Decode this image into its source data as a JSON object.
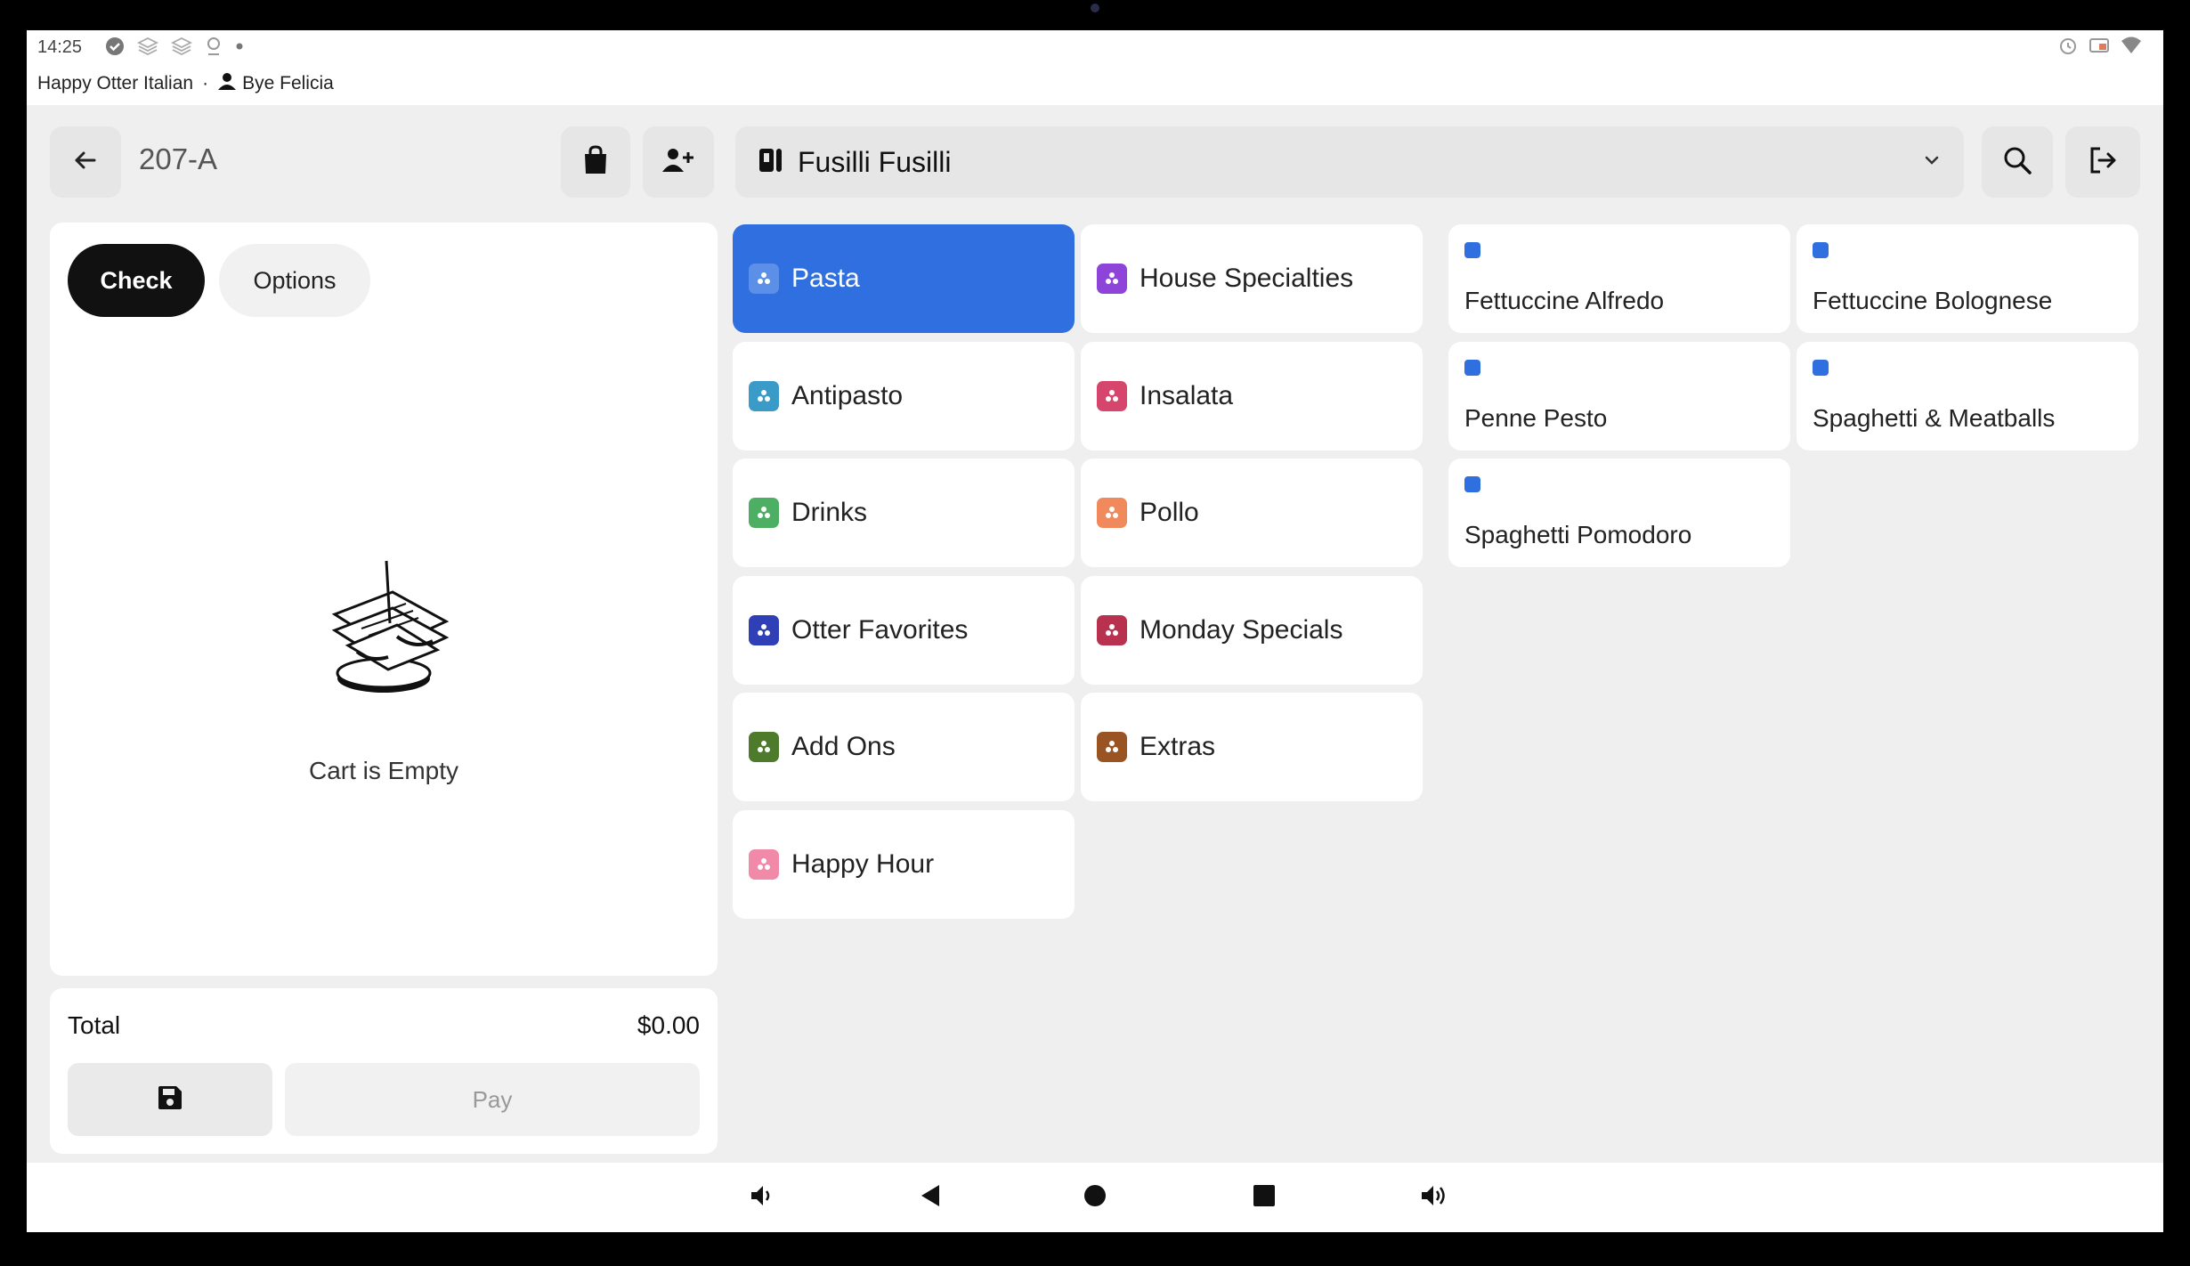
{
  "status_bar": {
    "time": "14:25",
    "location": "Happy Otter Italian",
    "separator": "·",
    "user": "Bye Felicia"
  },
  "header": {
    "order_id": "207-A",
    "menu_name": "Fusilli Fusilli"
  },
  "cart": {
    "tabs": [
      {
        "label": "Check",
        "active": true
      },
      {
        "label": "Options",
        "active": false
      }
    ],
    "empty_text": "Cart is Empty",
    "total_label": "Total",
    "total_value": "$0.00",
    "pay_label": "Pay"
  },
  "categories": [
    {
      "label": "Pasta",
      "color": "#2f6fe0",
      "active": true
    },
    {
      "label": "House Specialties",
      "color": "#8e44d8"
    },
    {
      "label": "Antipasto",
      "color": "#3a9bc9"
    },
    {
      "label": "Insalata",
      "color": "#d6456b"
    },
    {
      "label": "Drinks",
      "color": "#4caf63"
    },
    {
      "label": "Pollo",
      "color": "#f08a5d"
    },
    {
      "label": "Otter Favorites",
      "color": "#2f3fb5"
    },
    {
      "label": "Monday Specials",
      "color": "#b8324f"
    },
    {
      "label": "Add Ons",
      "color": "#4d7a2b"
    },
    {
      "label": "Extras",
      "color": "#9a5424"
    },
    {
      "label": "Happy Hour",
      "color": "#f08aa8"
    }
  ],
  "items": [
    {
      "label": "Fettuccine Alfredo"
    },
    {
      "label": "Fettuccine Bolognese"
    },
    {
      "label": "Penne Pesto"
    },
    {
      "label": "Spaghetti & Meatballs"
    },
    {
      "label": "Spaghetti Pomodoro"
    }
  ],
  "colors": {
    "accent": "#2f6fe0",
    "background": "#efefef",
    "card": "#ffffff"
  }
}
